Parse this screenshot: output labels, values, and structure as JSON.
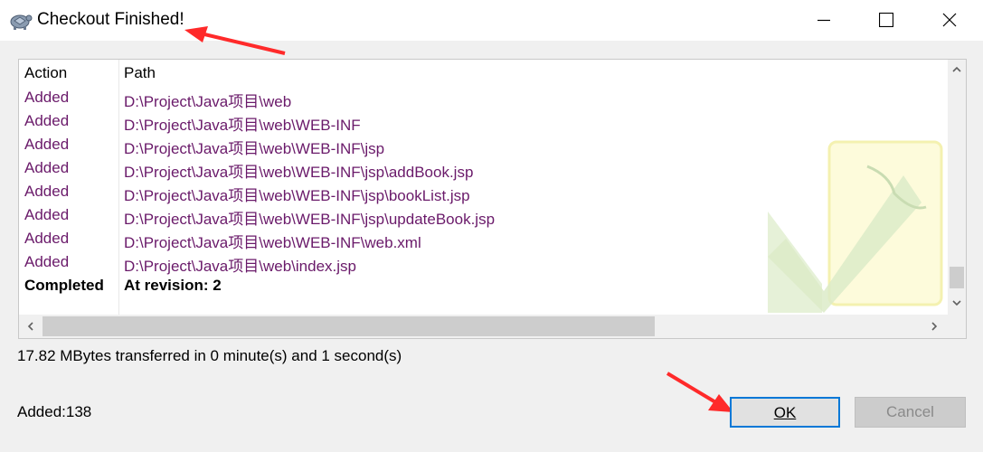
{
  "window": {
    "title": "Checkout Finished!",
    "icons": {
      "app": "tortoise-icon",
      "minimize": "minimize-icon",
      "maximize": "maximize-icon",
      "close": "close-icon"
    }
  },
  "list": {
    "columns": {
      "action": "Action",
      "path": "Path"
    },
    "rows": [
      {
        "action": "Added",
        "path": "D:\\Project\\Java项目\\web",
        "kind": "added"
      },
      {
        "action": "Added",
        "path": "D:\\Project\\Java项目\\web\\WEB-INF",
        "kind": "added"
      },
      {
        "action": "Added",
        "path": "D:\\Project\\Java项目\\web\\WEB-INF\\jsp",
        "kind": "added"
      },
      {
        "action": "Added",
        "path": "D:\\Project\\Java项目\\web\\WEB-INF\\jsp\\addBook.jsp",
        "kind": "added"
      },
      {
        "action": "Added",
        "path": "D:\\Project\\Java项目\\web\\WEB-INF\\jsp\\bookList.jsp",
        "kind": "added"
      },
      {
        "action": "Added",
        "path": "D:\\Project\\Java项目\\web\\WEB-INF\\jsp\\updateBook.jsp",
        "kind": "added"
      },
      {
        "action": "Added",
        "path": "D:\\Project\\Java项目\\web\\WEB-INF\\web.xml",
        "kind": "added"
      },
      {
        "action": "Added",
        "path": "D:\\Project\\Java项目\\web\\index.jsp",
        "kind": "added"
      },
      {
        "action": "Completed",
        "path": "At revision: 2",
        "kind": "completed"
      }
    ],
    "colors": {
      "added": "#6a1a6a",
      "completed": "#000000"
    }
  },
  "status": {
    "transfer": "17.82 MBytes transferred in 0 minute(s) and 1 second(s)",
    "added_count": "Added:138"
  },
  "buttons": {
    "ok": "OK",
    "cancel": "Cancel"
  },
  "accent": "#0078d7",
  "annotation_color": "#ff2a2a"
}
